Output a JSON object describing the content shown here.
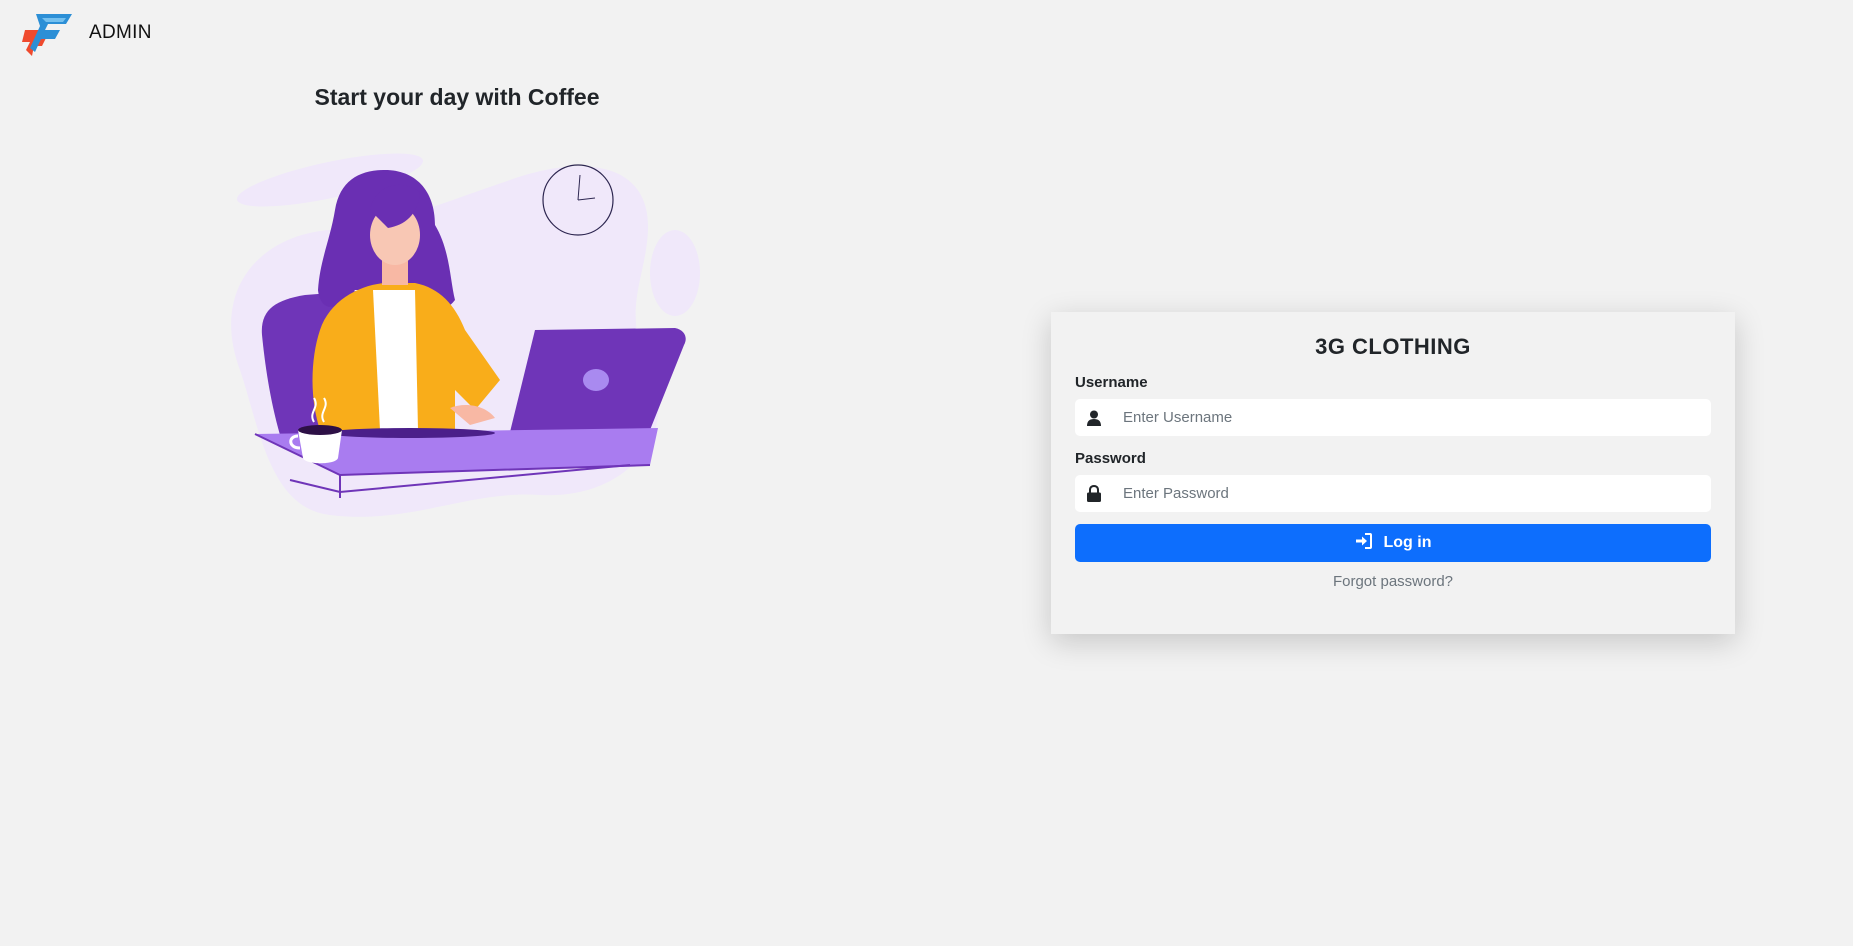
{
  "header": {
    "app_title": "ADMIN",
    "logo_icon": "brand-f-logo"
  },
  "hero": {
    "title": "Start your day with Coffee",
    "illustration": "woman-with-laptop-and-coffee-illustration"
  },
  "login": {
    "title": "3G CLOTHING",
    "username_label": "Username",
    "username_placeholder": "Enter Username",
    "username_value": "",
    "username_icon": "user-icon",
    "password_label": "Password",
    "password_placeholder": "Enter Password",
    "password_value": "",
    "password_icon": "lock-icon",
    "submit_label": "Log in",
    "submit_icon": "sign-in-icon",
    "forgot_label": "Forgot password?"
  },
  "colors": {
    "background": "#f2f2f2",
    "primary": "#0d6efd",
    "purple": "#6f35b8",
    "light_purple": "#f0e8fa",
    "mustard": "#f9ad1a"
  }
}
